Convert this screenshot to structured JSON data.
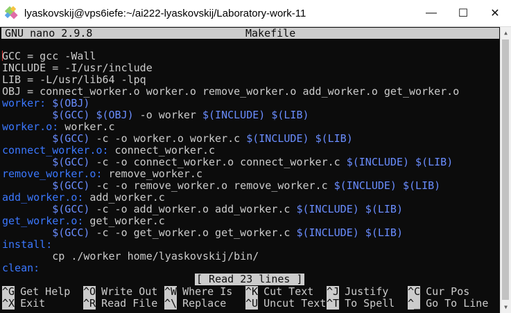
{
  "window": {
    "title": "lyaskovskij@vps6iefe:~/ai222-lyaskovskij/Laboratory-work-11",
    "minimize_glyph": "—",
    "maximize_glyph": "☐",
    "close_glyph": "✕"
  },
  "nano": {
    "version": "GNU nano 2.9.8",
    "filename": "Makefile",
    "status": "[ Read 23 lines ]"
  },
  "lines": [
    {
      "text": "GCC = gcc -Wall",
      "kind": "plain"
    },
    {
      "text": "INCLUDE = -I/usr/include",
      "kind": "plain"
    },
    {
      "text": "LIB = -L/usr/lib64 -lpq",
      "kind": "plain"
    },
    {
      "text": "OBJ = connect_worker.o worker.o remove_worker.o add_worker.o get_worker.o",
      "kind": "plain"
    },
    {
      "target": "worker:",
      "rest": " $(OBJ)",
      "kind": "target"
    },
    {
      "indent": "        ",
      "v1": "$(GCC)",
      "mid1": " ",
      "v2": "$(OBJ)",
      "mid2": " -o worker ",
      "v3": "$(INCLUDE)",
      "mid3": " ",
      "v4": "$(LIB)",
      "kind": "cmd4"
    },
    {
      "target": "worker.o:",
      "rest": " worker.c",
      "kind": "target_plain"
    },
    {
      "indent": "        ",
      "v1": "$(GCC)",
      "mid1": " -c -o worker.o worker.c ",
      "v2": "$(INCLUDE)",
      "mid2": " ",
      "v3": "$(LIB)",
      "kind": "cmd3"
    },
    {
      "target": "connect_worker.o:",
      "rest": " connect_worker.c",
      "kind": "target_plain"
    },
    {
      "indent": "        ",
      "v1": "$(GCC)",
      "mid1": " -c -o connect_worker.o connect_worker.c ",
      "v2": "$(INCLUDE)",
      "mid2": " ",
      "v3": "$(LIB)",
      "kind": "cmd3"
    },
    {
      "target": "remove_worker.o:",
      "rest": " remove_worker.c",
      "kind": "target_plain"
    },
    {
      "indent": "        ",
      "v1": "$(GCC)",
      "mid1": " -c -o remove_worker.o remove_worker.c ",
      "v2": "$(INCLUDE)",
      "mid2": " ",
      "v3": "$(LIB)",
      "kind": "cmd3"
    },
    {
      "target": "add_worker.o:",
      "rest": " add_worker.c",
      "kind": "target_plain"
    },
    {
      "indent": "        ",
      "v1": "$(GCC)",
      "mid1": " -c -o add_worker.o add_worker.c ",
      "v2": "$(INCLUDE)",
      "mid2": " ",
      "v3": "$(LIB)",
      "kind": "cmd3"
    },
    {
      "target": "get_worker.o:",
      "rest": " get_worker.c",
      "kind": "target_plain"
    },
    {
      "indent": "        ",
      "v1": "$(GCC)",
      "mid1": " -c -o get_worker.o get_worker.c ",
      "v2": "$(INCLUDE)",
      "mid2": " ",
      "v3": "$(LIB)",
      "kind": "cmd3"
    },
    {
      "target": "install:",
      "rest": "",
      "kind": "target_plain"
    },
    {
      "text": "        cp ./worker home/lyaskovskij/bin/",
      "kind": "plain"
    },
    {
      "target": "clean:",
      "rest": "",
      "kind": "target_plain"
    }
  ],
  "shortcuts": [
    [
      {
        "key": "^G",
        "label": "Get Help"
      },
      {
        "key": "^O",
        "label": "Write Out"
      },
      {
        "key": "^W",
        "label": "Where Is"
      },
      {
        "key": "^K",
        "label": "Cut Text"
      },
      {
        "key": "^J",
        "label": "Justify"
      },
      {
        "key": "^C",
        "label": "Cur Pos"
      }
    ],
    [
      {
        "key": "^X",
        "label": "Exit"
      },
      {
        "key": "^R",
        "label": "Read File"
      },
      {
        "key": "^\\",
        "label": "Replace"
      },
      {
        "key": "^U",
        "label": "Uncut Text"
      },
      {
        "key": "^T",
        "label": "To Spell"
      },
      {
        "key": "^_",
        "label": "Go To Line"
      }
    ]
  ],
  "colors": {
    "background": "#0c0c0c",
    "text": "#cccccc",
    "target": "#3b78ff",
    "variable": "#6a8dff"
  }
}
